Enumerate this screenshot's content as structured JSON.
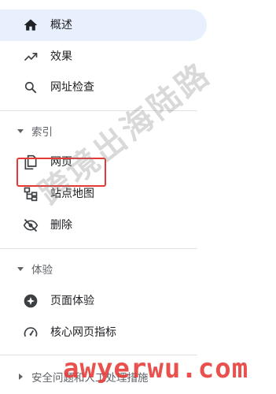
{
  "nav": {
    "items": [
      {
        "label": "概述",
        "icon": "home-icon",
        "active": true
      },
      {
        "label": "效果",
        "icon": "trending-up-icon"
      },
      {
        "label": "网址检查",
        "icon": "search-icon"
      },
      {
        "label": "网页",
        "icon": "copy-pages-icon"
      },
      {
        "label": "站点地图",
        "icon": "sitemap-icon"
      },
      {
        "label": "删除",
        "icon": "visibility-off-icon"
      },
      {
        "label": "页面体验",
        "icon": "page-experience-icon"
      },
      {
        "label": "核心网页指标",
        "icon": "speed-gauge-icon"
      }
    ],
    "sections": {
      "index": "索引",
      "experience": "体验",
      "security": "安全问题和人工处理措施"
    }
  },
  "colors": {
    "active_bg": "#e8f0fe",
    "highlight_border": "#e53935",
    "icon": "#3c4043",
    "text": "#202124"
  },
  "watermarks": {
    "diagonal": "跨境出海陆路",
    "footer": "awyerwu.com"
  }
}
